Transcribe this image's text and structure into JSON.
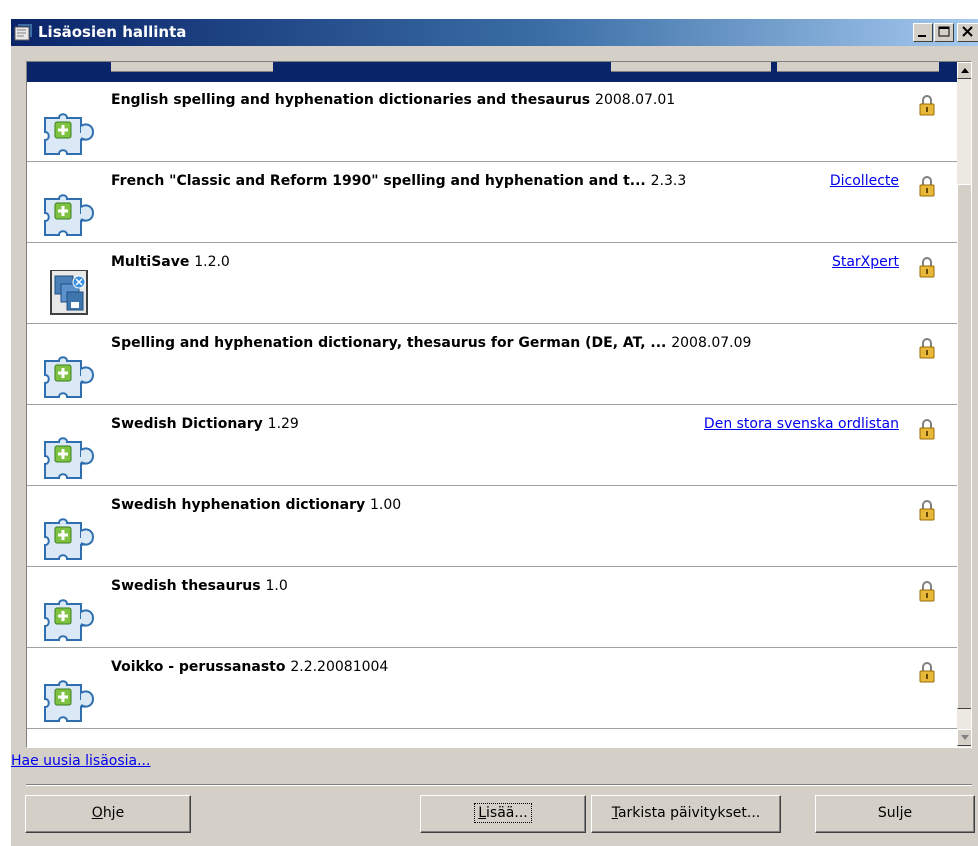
{
  "window": {
    "title": "Lisäosien hallinta"
  },
  "extensions": [
    {
      "name": "English spelling and hyphenation dictionaries and thesaurus",
      "version": "2008.07.01",
      "publisher": "",
      "icon": "puzzle-icon"
    },
    {
      "name": "French \"Classic and Reform 1990\" spelling and hyphenation and t...",
      "version": "2.3.3",
      "publisher": "Dicollecte",
      "icon": "puzzle-icon"
    },
    {
      "name": "MultiSave",
      "version": "1.2.0",
      "publisher": "StarXpert",
      "icon": "multisave-icon"
    },
    {
      "name": "Spelling and hyphenation dictionary, thesaurus for German (DE, AT, ...",
      "version": "2008.07.09",
      "publisher": "",
      "icon": "puzzle-icon"
    },
    {
      "name": "Swedish Dictionary",
      "version": "1.29",
      "publisher": "Den stora svenska ordlistan",
      "icon": "puzzle-icon"
    },
    {
      "name": "Swedish hyphenation dictionary",
      "version": "1.00",
      "publisher": "",
      "icon": "puzzle-icon"
    },
    {
      "name": "Swedish thesaurus",
      "version": "1.0",
      "publisher": "",
      "icon": "puzzle-icon"
    },
    {
      "name": "Voikko - perussanasto",
      "version": "2.2.20081004",
      "publisher": "",
      "icon": "puzzle-icon"
    }
  ],
  "links": {
    "get_more": "Hae uusia lisäosia..."
  },
  "buttons": {
    "help": {
      "mnemonic": "O",
      "rest": "hje"
    },
    "add": {
      "mnemonic": "L",
      "rest": "isää..."
    },
    "check_updates": {
      "mnemonic": "T",
      "rest": "arkista päivitykset..."
    },
    "close": "Sulje"
  },
  "colors": {
    "title_bar_start": "#0a246a",
    "title_bar_end": "#a6caf0",
    "selection": "#0a246a",
    "link": "#0000ee",
    "face": "#d4d0c8"
  }
}
